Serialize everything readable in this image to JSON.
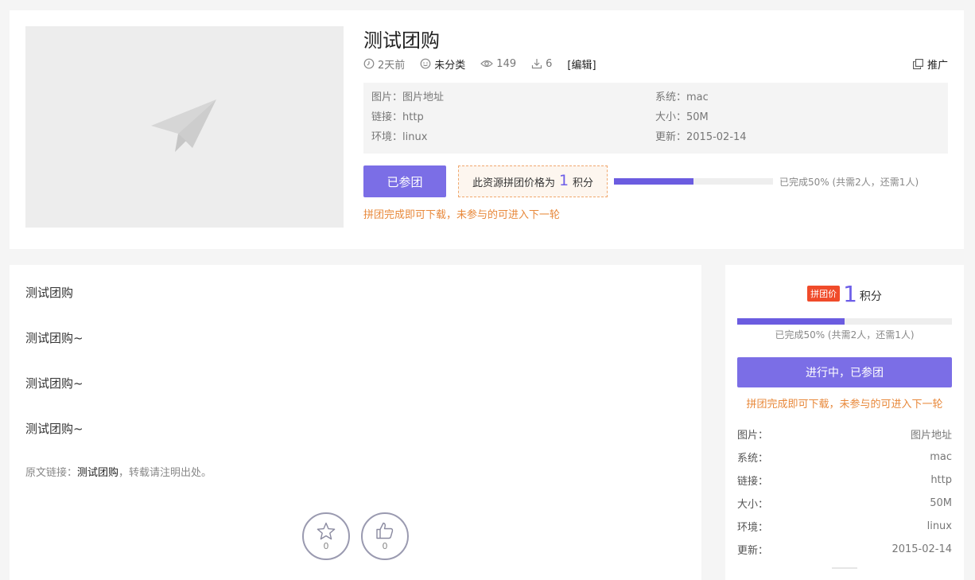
{
  "title": "测试团购",
  "meta": {
    "time": "2天前",
    "category": "未分类",
    "views": "149",
    "downloads": "6",
    "edit": "[编辑]",
    "promote": "推广"
  },
  "info": {
    "image_label": "图片：",
    "image_value": "图片地址",
    "link_label": "链接：",
    "link_value": "http",
    "env_label": "环境：",
    "env_value": "linux",
    "system_label": "系统：",
    "system_value": "mac",
    "size_label": "大小：",
    "size_value": "50M",
    "update_label": "更新：",
    "update_value": "2015-02-14"
  },
  "group": {
    "joined_label": "已参团",
    "price_prefix": "此资源拼团价格为",
    "price_value": "1",
    "price_unit": "积分",
    "progress_percent": 50,
    "progress_text": "已完成50% (共需2人，还需1人)",
    "notice": "拼团完成即可下载，未参与的可进入下一轮"
  },
  "article": {
    "paragraphs": [
      "测试团购",
      "测试团购~",
      "测试团购~",
      "测试团购~"
    ],
    "source_prefix": "原文链接：",
    "source_link": "测试团购",
    "source_suffix": "，转载请注明出处。",
    "favorite_count": "0",
    "like_count": "0"
  },
  "sidebar": {
    "badge": "拼团价",
    "price_value": "1",
    "price_unit": "积分",
    "progress_percent": 50,
    "progress_text": "已完成50% (共需2人，还需1人)",
    "button_label": "进行中，已参团",
    "notice": "拼团完成即可下载，未参与的可进入下一轮",
    "rows": [
      {
        "label": "图片：",
        "value": "图片地址"
      },
      {
        "label": "系统：",
        "value": "mac"
      },
      {
        "label": "链接：",
        "value": "http"
      },
      {
        "label": "大小：",
        "value": "50M"
      },
      {
        "label": "环境：",
        "value": "linux"
      },
      {
        "label": "更新：",
        "value": "2015-02-14"
      }
    ]
  },
  "colors": {
    "accent": "#7b6ee6",
    "progress": "#6b5ce0",
    "notice": "#e8883a",
    "badge": "#f04b2a"
  },
  "icons": [
    "paper-plane-icon",
    "clock-icon",
    "category-face-icon",
    "eye-icon",
    "download-icon",
    "copy-icon",
    "star-icon",
    "thumbs-up-icon"
  ]
}
